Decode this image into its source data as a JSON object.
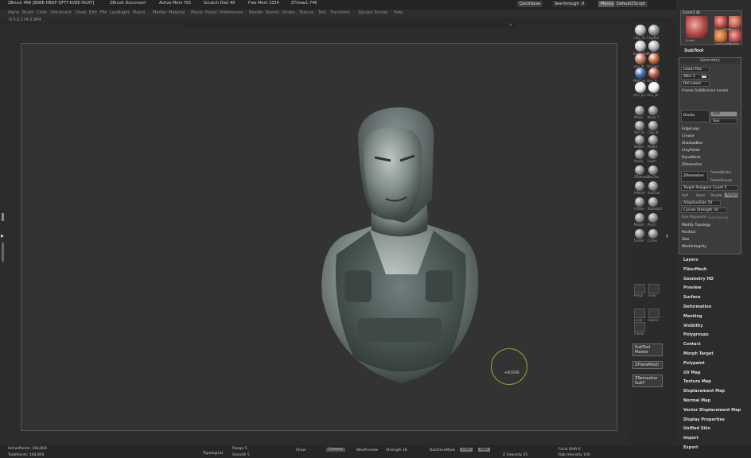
{
  "titlebar": {
    "app": "ZBrush 4R6 [BIWE-HBGF-QFTY-KVEE-HGXT]",
    "document": "ZBrush Document",
    "active_mem": "Active Mem 761",
    "scratch_disk": "Scratch Disk 49",
    "free_mem": "Free Mem 3334",
    "ztime": "ZTime▸1.746",
    "quicksave": "QuickSave",
    "see_through": "See-through",
    "see_through_value": "0",
    "menus_btn": "Menus",
    "default_script": "DefaultZScript"
  },
  "menubar": [
    "Alpha",
    "Brush",
    "Color",
    "Document",
    "Draw",
    "Edit",
    "File",
    "Layer",
    "Light",
    "Macro",
    "Marker",
    "Material",
    "Movie",
    "Picker",
    "Preferences",
    "Render",
    "Stencil",
    "Stroke",
    "Texture",
    "Tool",
    "Transform",
    "Zplugin",
    "Zscript",
    "Help"
  ],
  "coords": "-0.5,0.174,0.984",
  "brushes": [
    {
      "label": "Clay_Tu",
      "color": "#bdbdbd"
    },
    {
      "label": "ClayBui",
      "color": "#9a9a9a"
    },
    {
      "label": "Basic Ma",
      "color": "#c9c9c9"
    },
    {
      "label": "MatCap",
      "color": "#b8b8b8"
    },
    {
      "label": "skin_M",
      "color": "#c77a5a"
    },
    {
      "label": "Orange",
      "color": "#c76a3a"
    },
    {
      "label": "MatCap",
      "color": "#3e6fb3"
    },
    {
      "label": "skin_S",
      "color": "#b65a4a"
    },
    {
      "label": "skin_Ex",
      "color": "#eeeeee"
    },
    {
      "label": "skin_Dr",
      "color": "#f4f4f4"
    }
  ],
  "brushes2": [
    "Move",
    "Move T",
    "Std_Dr",
    "Clay_B",
    "Mallet",
    "Mallet",
    "Hpoly",
    "Layer",
    "ZRemesh",
    "DecTex",
    "hPolish",
    "SubTool",
    "Inflate",
    "Standard",
    "Morph",
    "Pinch",
    "Snake",
    "Curve"
  ],
  "side_buttons": [
    "SubTool Master",
    "ZPlaneMesh",
    "ZRemesher SubT"
  ],
  "side_small": [
    "Persp",
    "Floor",
    "Local",
    "Gizmo",
    "Frame"
  ],
  "tool_thumbs": [
    "Eraser",
    "SimpleBrush",
    "Eraser2",
    "LineRemesh",
    "Subtool"
  ],
  "tool_thumb_label": "Eraser2 48",
  "subtool": {
    "header": "SubTool",
    "geometry_header": "Geometry",
    "lower_res": "Lower Res",
    "sdiv": "SDiv 3",
    "del_lower": "Del Lower",
    "freeze": "Freeze SubDivision Levels",
    "divide": "Divide",
    "smt": "Smt",
    "suv": "Suv",
    "edgeloop": "EdgeLoop",
    "crease": "Crease",
    "shadowbox": "ShadowBox",
    "claypolish": "ClayPolish",
    "dynamesh": "DynaMesh",
    "zremesher": "ZRemesher",
    "zremesher_btn": "ZRemesher",
    "freeze_border": "FreezeBorder",
    "freeze_groups": "FreezeGroups",
    "target_polygons": "Target Polygons Count",
    "target_polygons_value": "5",
    "half": "Half",
    "same": "Same",
    "double": "Double",
    "adapt": "Adapt",
    "adaptive_size": "AdaptiveSize",
    "adaptive_size_value": "50",
    "curves_strength": "Curves Strength",
    "curves_strength_value": "50",
    "use_polypaint": "Use Polypaint",
    "color_density": "ColorDensity",
    "modify_topology": "Modify Topology",
    "position": "Position",
    "size": "Size",
    "mesh_integrity": "MeshIntegrity"
  },
  "sections": [
    "Layers",
    "FiberMesh",
    "Geometry HD",
    "Preview",
    "Surface",
    "Deformation",
    "Masking",
    "Visibility",
    "Polygroups",
    "Contact",
    "Morph Target",
    "Polypaint",
    "UV Map",
    "Texture Map",
    "Displacement Map",
    "Normal Map",
    "Vector Displacement Map",
    "Display Properties",
    "Unified Skin",
    "Import",
    "Export"
  ],
  "gizmo_label": "+ROTATE",
  "bottombar": {
    "active_points": "ActivePoints: 164,804",
    "total_points": "TotalPoints: 164,804",
    "topological": "Topological",
    "range": "Range",
    "range_value": "5",
    "smooth": "Smooth",
    "smooth_value": "5",
    "show": "Show",
    "camera_btn": "Camera",
    "wax_preview": "WaxPreview",
    "strength": "Strength",
    "strength_value": "18",
    "backface_mask": "BackfaceMask",
    "cold": "Cold",
    "rgb": "Rgb",
    "focal_shift": "Focal Shift",
    "focal_shift_value": "0",
    "rgb_intensity": "Rgb Intensity",
    "rgb_intensity_value": "100",
    "z_intensity": "Z Intensity",
    "z_intensity_value": "25"
  }
}
